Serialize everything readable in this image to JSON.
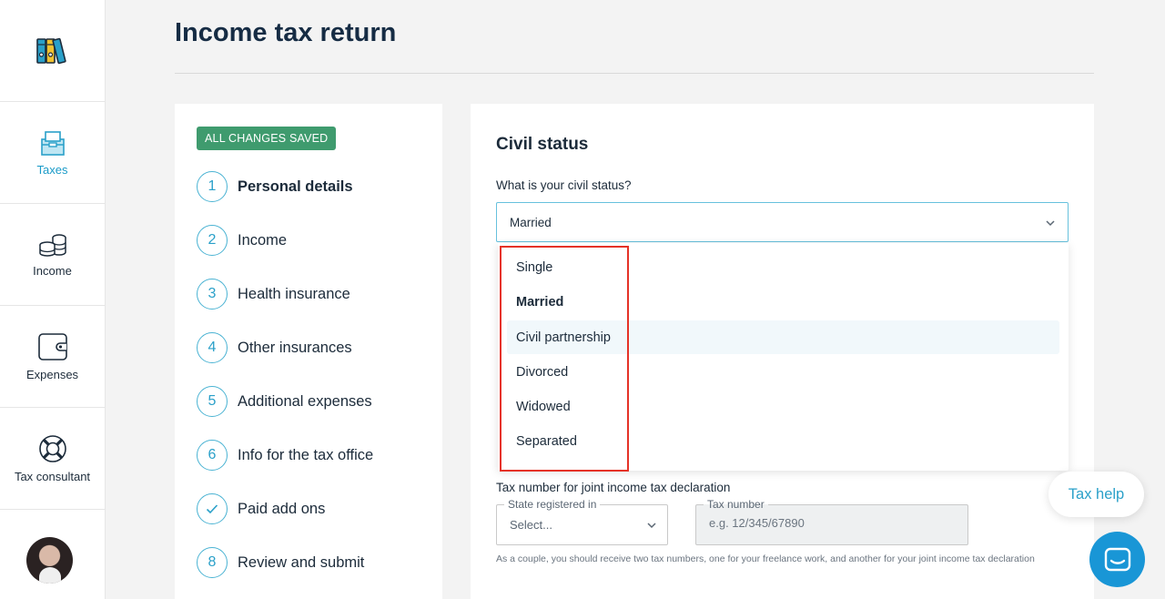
{
  "nav": {
    "items": [
      {
        "label": "Taxes",
        "icon": "taxes-box-icon",
        "active": true
      },
      {
        "label": "Income",
        "icon": "coins-icon",
        "active": false
      },
      {
        "label": "Expenses",
        "icon": "wallet-icon",
        "active": false
      },
      {
        "label": "Tax consultant",
        "icon": "lifebuoy-icon",
        "active": false
      }
    ],
    "logo_icon": "binders-logo-icon",
    "avatar": "user-avatar"
  },
  "header": {
    "title": "Income tax return"
  },
  "steps": {
    "badge": "ALL CHANGES SAVED",
    "items": [
      {
        "num": "1",
        "label": "Personal details",
        "current": true
      },
      {
        "num": "2",
        "label": "Income"
      },
      {
        "num": "3",
        "label": "Health insurance"
      },
      {
        "num": "4",
        "label": "Other insurances"
      },
      {
        "num": "5",
        "label": "Additional expenses"
      },
      {
        "num": "6",
        "label": "Info for the tax office"
      },
      {
        "num": "",
        "label": "Paid add ons",
        "icon": "checkmark-icon"
      },
      {
        "num": "8",
        "label": "Review and submit"
      }
    ]
  },
  "form": {
    "section_title": "Civil status",
    "question": "What is your civil status?",
    "selected_value": "Married",
    "options": [
      "Single",
      "Married",
      "Civil partnership",
      "Divorced",
      "Widowed",
      "Separated"
    ],
    "hovered_option": "Civil partnership",
    "tax_number_label": "Tax number for joint income tax declaration",
    "state_legend": "State registered in",
    "state_value": "Select...",
    "tax_number_legend": "Tax number",
    "tax_number_placeholder": "e.g. 12/345/67890",
    "hint": "As a couple, you should receive two tax numbers, one for your freelance work, and another for your joint income tax declaration"
  },
  "help": {
    "label": "Tax help",
    "chat_icon": "chat-icon"
  },
  "colors": {
    "accent": "#2aa0c9",
    "badge": "#3f9b6e",
    "highlight_box": "#e53227",
    "chat": "#1996d6"
  }
}
